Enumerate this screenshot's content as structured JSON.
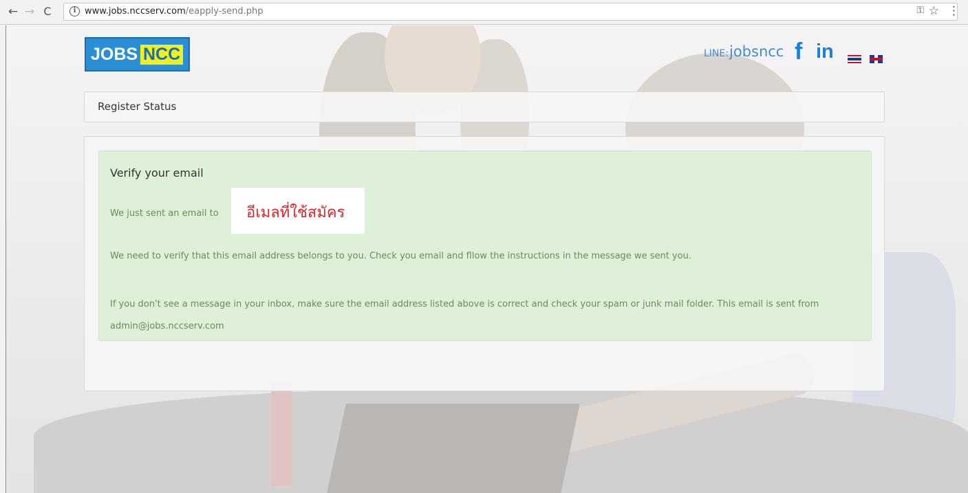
{
  "browser": {
    "back_icon": "←",
    "forward_icon": "→",
    "reload_icon": "C",
    "info_icon": "i",
    "url_host": "www.jobs.nccserv.com",
    "url_path": "/eapply-send.php",
    "key_icon": "⚿",
    "star_icon": "☆",
    "menu_icon": "⋮"
  },
  "header": {
    "logo_part1": "JOBS",
    "logo_part2": "NCC",
    "line_label": "LINE:",
    "line_id": "jobsncc",
    "facebook_icon": "f",
    "linkedin_icon": "in"
  },
  "status": {
    "title": "Register Status"
  },
  "alert": {
    "title": "Verify your email",
    "line1": "We just sent an email to",
    "email_placeholder": "อีเมลที่ใช้สมัคร",
    "line2": "We need to verify that this email address belongs to you. Check you email and fllow the instructions in the message we sent you.",
    "line3": "If you don't see a message in your inbox, make sure the email address listed above is correct and check your spam or junk mail folder. This email is sent from admin@jobs.nccserv.com"
  },
  "colors": {
    "accent": "#2b8fd6",
    "alert_bg": "#dff0d8",
    "highlight_text": "#e0262b",
    "logo_yellow": "#f4f01a"
  }
}
